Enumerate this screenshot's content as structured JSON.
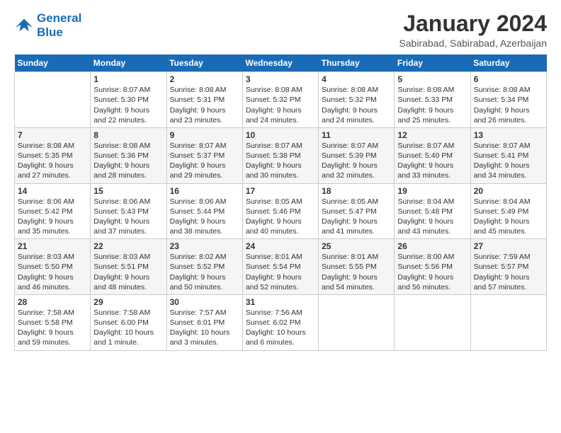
{
  "logo": {
    "line1": "General",
    "line2": "Blue"
  },
  "title": "January 2024",
  "subtitle": "Sabirabad, Sabirabad, Azerbaijan",
  "days_of_week": [
    "Sunday",
    "Monday",
    "Tuesday",
    "Wednesday",
    "Thursday",
    "Friday",
    "Saturday"
  ],
  "weeks": [
    [
      {
        "day": "",
        "sunrise": "",
        "sunset": "",
        "daylight": ""
      },
      {
        "day": "1",
        "sunrise": "Sunrise: 8:07 AM",
        "sunset": "Sunset: 5:30 PM",
        "daylight": "Daylight: 9 hours and 22 minutes."
      },
      {
        "day": "2",
        "sunrise": "Sunrise: 8:08 AM",
        "sunset": "Sunset: 5:31 PM",
        "daylight": "Daylight: 9 hours and 23 minutes."
      },
      {
        "day": "3",
        "sunrise": "Sunrise: 8:08 AM",
        "sunset": "Sunset: 5:32 PM",
        "daylight": "Daylight: 9 hours and 24 minutes."
      },
      {
        "day": "4",
        "sunrise": "Sunrise: 8:08 AM",
        "sunset": "Sunset: 5:32 PM",
        "daylight": "Daylight: 9 hours and 24 minutes."
      },
      {
        "day": "5",
        "sunrise": "Sunrise: 8:08 AM",
        "sunset": "Sunset: 5:33 PM",
        "daylight": "Daylight: 9 hours and 25 minutes."
      },
      {
        "day": "6",
        "sunrise": "Sunrise: 8:08 AM",
        "sunset": "Sunset: 5:34 PM",
        "daylight": "Daylight: 9 hours and 26 minutes."
      }
    ],
    [
      {
        "day": "7",
        "sunrise": "Sunrise: 8:08 AM",
        "sunset": "Sunset: 5:35 PM",
        "daylight": "Daylight: 9 hours and 27 minutes."
      },
      {
        "day": "8",
        "sunrise": "Sunrise: 8:08 AM",
        "sunset": "Sunset: 5:36 PM",
        "daylight": "Daylight: 9 hours and 28 minutes."
      },
      {
        "day": "9",
        "sunrise": "Sunrise: 8:07 AM",
        "sunset": "Sunset: 5:37 PM",
        "daylight": "Daylight: 9 hours and 29 minutes."
      },
      {
        "day": "10",
        "sunrise": "Sunrise: 8:07 AM",
        "sunset": "Sunset: 5:38 PM",
        "daylight": "Daylight: 9 hours and 30 minutes."
      },
      {
        "day": "11",
        "sunrise": "Sunrise: 8:07 AM",
        "sunset": "Sunset: 5:39 PM",
        "daylight": "Daylight: 9 hours and 32 minutes."
      },
      {
        "day": "12",
        "sunrise": "Sunrise: 8:07 AM",
        "sunset": "Sunset: 5:40 PM",
        "daylight": "Daylight: 9 hours and 33 minutes."
      },
      {
        "day": "13",
        "sunrise": "Sunrise: 8:07 AM",
        "sunset": "Sunset: 5:41 PM",
        "daylight": "Daylight: 9 hours and 34 minutes."
      }
    ],
    [
      {
        "day": "14",
        "sunrise": "Sunrise: 8:06 AM",
        "sunset": "Sunset: 5:42 PM",
        "daylight": "Daylight: 9 hours and 35 minutes."
      },
      {
        "day": "15",
        "sunrise": "Sunrise: 8:06 AM",
        "sunset": "Sunset: 5:43 PM",
        "daylight": "Daylight: 9 hours and 37 minutes."
      },
      {
        "day": "16",
        "sunrise": "Sunrise: 8:06 AM",
        "sunset": "Sunset: 5:44 PM",
        "daylight": "Daylight: 9 hours and 38 minutes."
      },
      {
        "day": "17",
        "sunrise": "Sunrise: 8:05 AM",
        "sunset": "Sunset: 5:46 PM",
        "daylight": "Daylight: 9 hours and 40 minutes."
      },
      {
        "day": "18",
        "sunrise": "Sunrise: 8:05 AM",
        "sunset": "Sunset: 5:47 PM",
        "daylight": "Daylight: 9 hours and 41 minutes."
      },
      {
        "day": "19",
        "sunrise": "Sunrise: 8:04 AM",
        "sunset": "Sunset: 5:48 PM",
        "daylight": "Daylight: 9 hours and 43 minutes."
      },
      {
        "day": "20",
        "sunrise": "Sunrise: 8:04 AM",
        "sunset": "Sunset: 5:49 PM",
        "daylight": "Daylight: 9 hours and 45 minutes."
      }
    ],
    [
      {
        "day": "21",
        "sunrise": "Sunrise: 8:03 AM",
        "sunset": "Sunset: 5:50 PM",
        "daylight": "Daylight: 9 hours and 46 minutes."
      },
      {
        "day": "22",
        "sunrise": "Sunrise: 8:03 AM",
        "sunset": "Sunset: 5:51 PM",
        "daylight": "Daylight: 9 hours and 48 minutes."
      },
      {
        "day": "23",
        "sunrise": "Sunrise: 8:02 AM",
        "sunset": "Sunset: 5:52 PM",
        "daylight": "Daylight: 9 hours and 50 minutes."
      },
      {
        "day": "24",
        "sunrise": "Sunrise: 8:01 AM",
        "sunset": "Sunset: 5:54 PM",
        "daylight": "Daylight: 9 hours and 52 minutes."
      },
      {
        "day": "25",
        "sunrise": "Sunrise: 8:01 AM",
        "sunset": "Sunset: 5:55 PM",
        "daylight": "Daylight: 9 hours and 54 minutes."
      },
      {
        "day": "26",
        "sunrise": "Sunrise: 8:00 AM",
        "sunset": "Sunset: 5:56 PM",
        "daylight": "Daylight: 9 hours and 56 minutes."
      },
      {
        "day": "27",
        "sunrise": "Sunrise: 7:59 AM",
        "sunset": "Sunset: 5:57 PM",
        "daylight": "Daylight: 9 hours and 57 minutes."
      }
    ],
    [
      {
        "day": "28",
        "sunrise": "Sunrise: 7:58 AM",
        "sunset": "Sunset: 5:58 PM",
        "daylight": "Daylight: 9 hours and 59 minutes."
      },
      {
        "day": "29",
        "sunrise": "Sunrise: 7:58 AM",
        "sunset": "Sunset: 6:00 PM",
        "daylight": "Daylight: 10 hours and 1 minute."
      },
      {
        "day": "30",
        "sunrise": "Sunrise: 7:57 AM",
        "sunset": "Sunset: 6:01 PM",
        "daylight": "Daylight: 10 hours and 3 minutes."
      },
      {
        "day": "31",
        "sunrise": "Sunrise: 7:56 AM",
        "sunset": "Sunset: 6:02 PM",
        "daylight": "Daylight: 10 hours and 6 minutes."
      },
      {
        "day": "",
        "sunrise": "",
        "sunset": "",
        "daylight": ""
      },
      {
        "day": "",
        "sunrise": "",
        "sunset": "",
        "daylight": ""
      },
      {
        "day": "",
        "sunrise": "",
        "sunset": "",
        "daylight": ""
      }
    ]
  ]
}
